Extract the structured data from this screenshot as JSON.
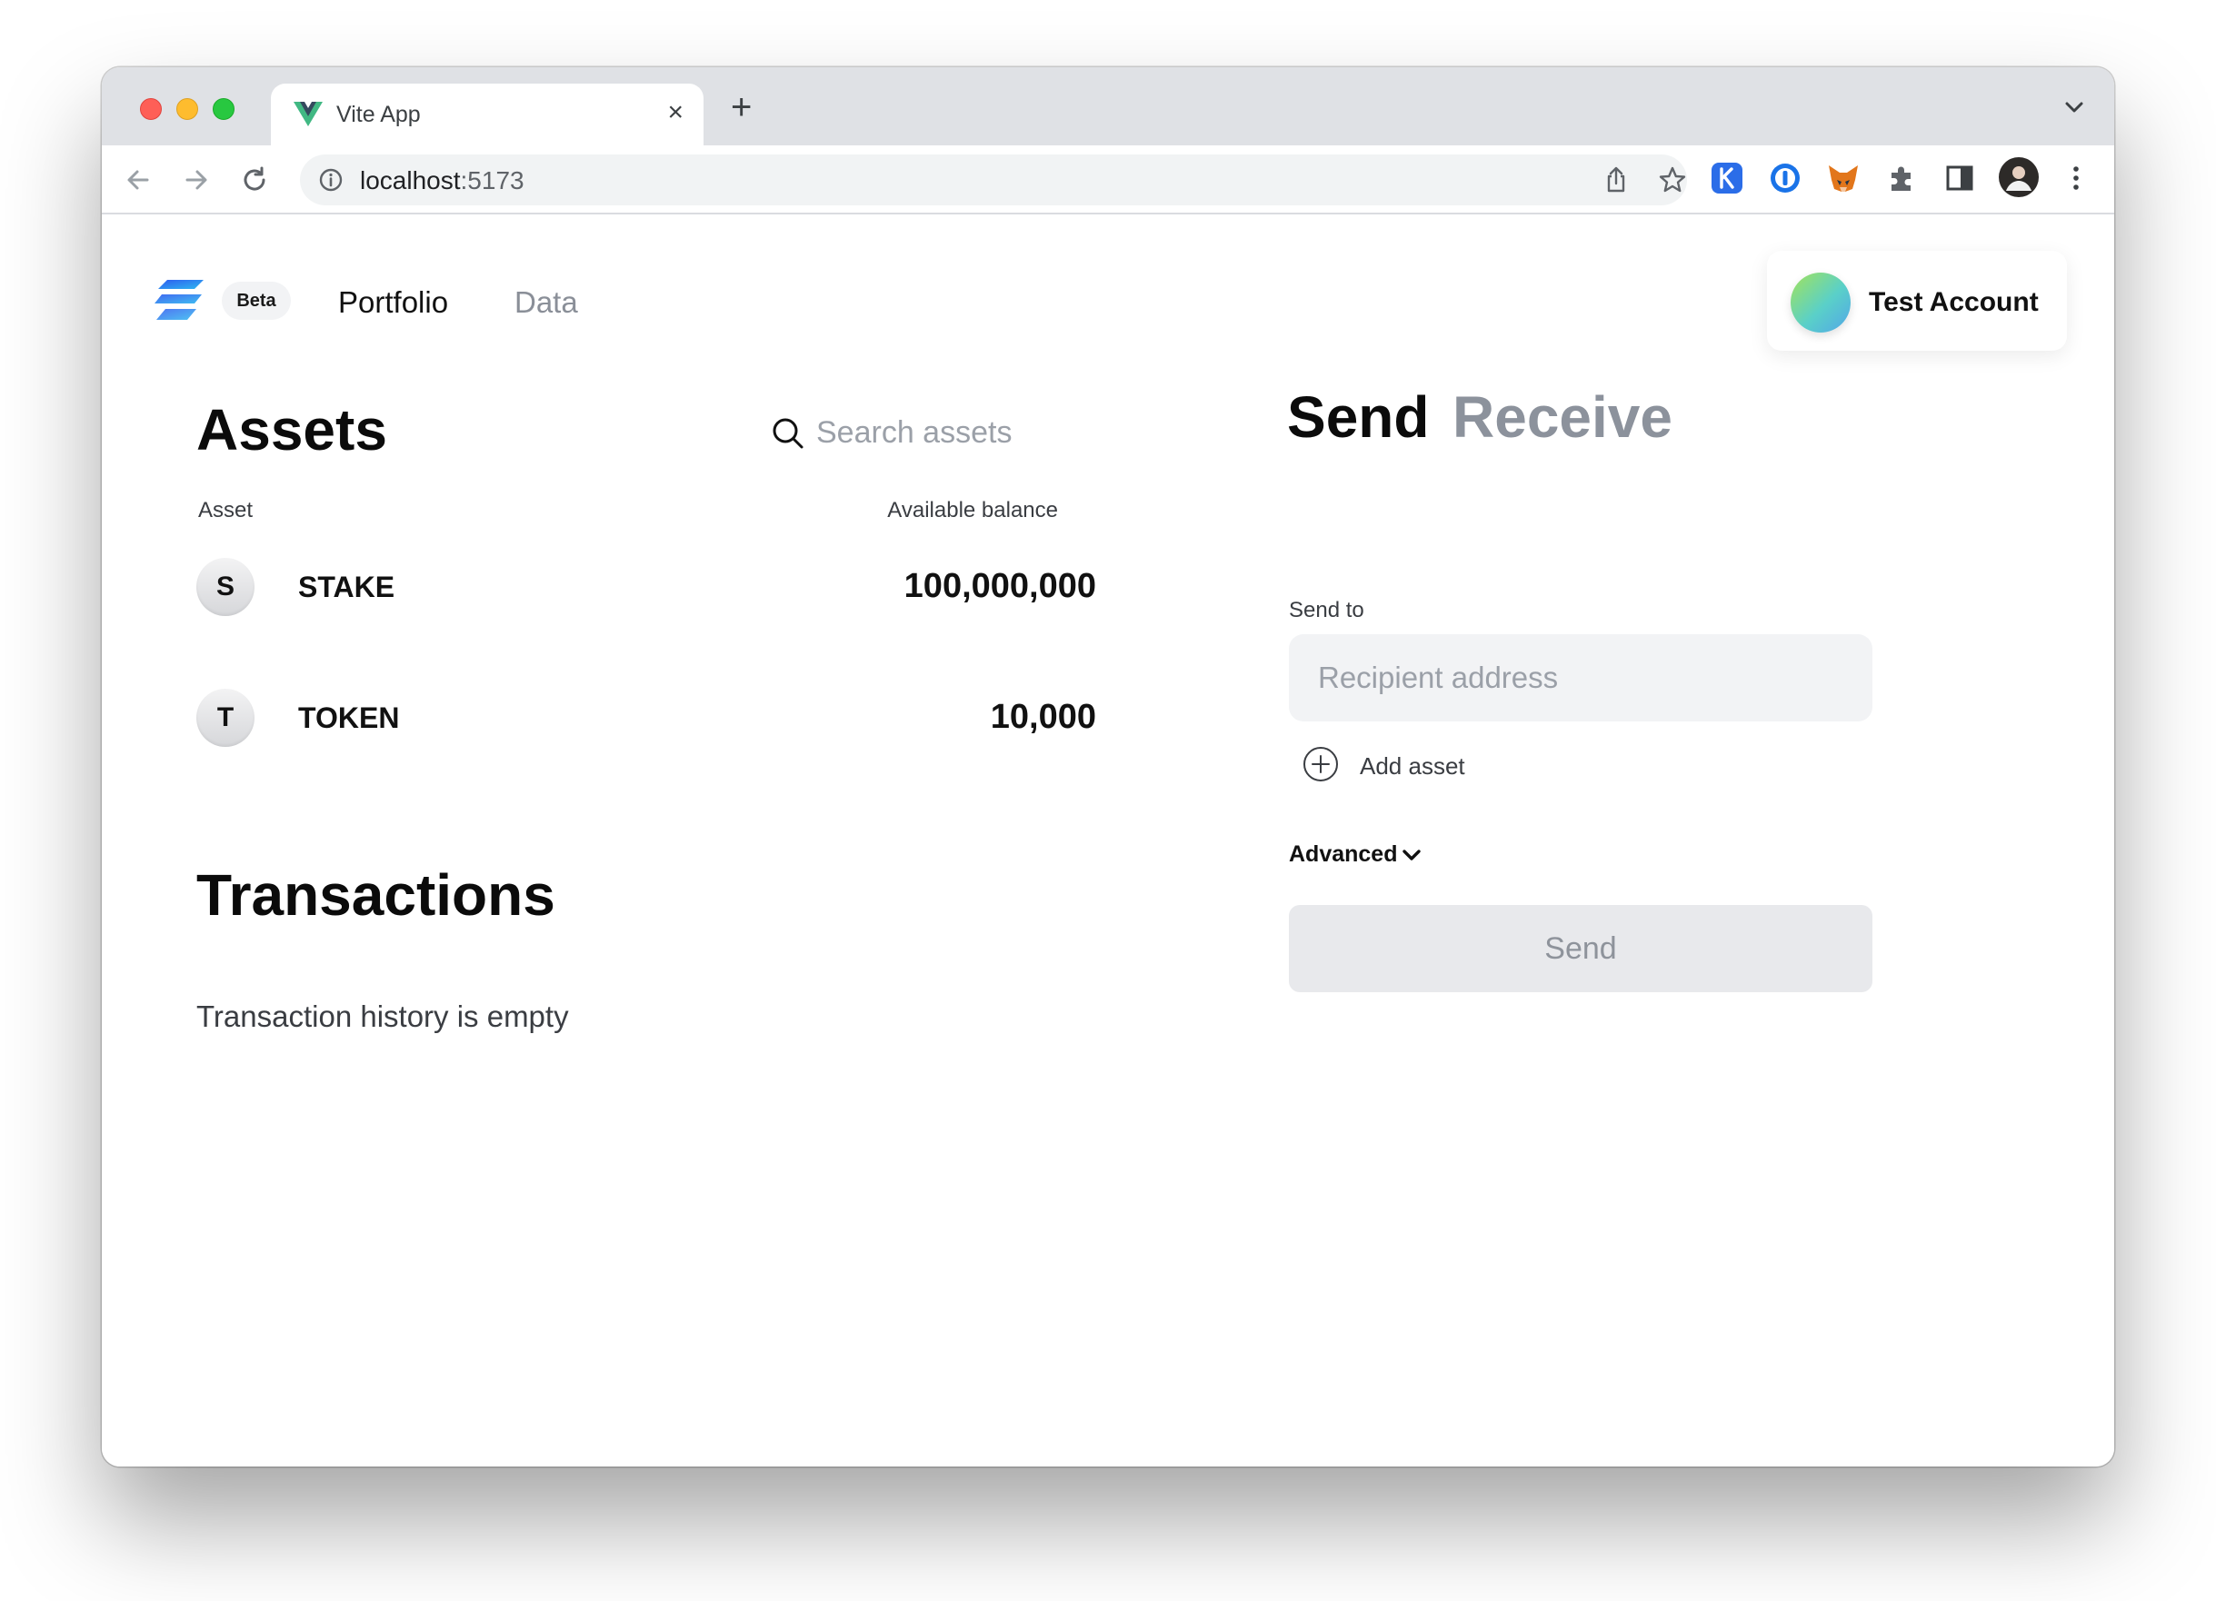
{
  "browser": {
    "tab_title": "Vite App",
    "tab_close": "×",
    "new_tab": "+",
    "url_host": "localhost",
    "url_port": ":5173",
    "icons": [
      "back-arrow-icon",
      "forward-arrow-icon",
      "reload-icon",
      "info-icon",
      "share-icon",
      "star-icon",
      "extension-k-icon",
      "password-manager-icon",
      "fox-wallet-icon",
      "puzzle-extensions-icon",
      "side-panel-icon",
      "profile-avatar-icon",
      "kebab-menu-icon"
    ]
  },
  "header": {
    "beta_label": "Beta",
    "nav": {
      "portfolio": "Portfolio",
      "data": "Data"
    },
    "account_name": "Test Account"
  },
  "assets": {
    "title": "Assets",
    "search_placeholder": "Search assets",
    "col_asset": "Asset",
    "col_balance": "Available balance",
    "rows": [
      {
        "letter": "S",
        "name": "STAKE",
        "amount": "100,000,000"
      },
      {
        "letter": "T",
        "name": "TOKEN",
        "amount": "10,000"
      }
    ]
  },
  "transactions": {
    "title": "Transactions",
    "empty_message": "Transaction history is empty"
  },
  "send_panel": {
    "tab_send": "Send",
    "tab_receive": "Receive",
    "send_to_label": "Send to",
    "recipient_placeholder": "Recipient address",
    "add_asset_label": "Add asset",
    "advanced_label": "Advanced",
    "send_button_label": "Send"
  },
  "colors": {
    "text_primary": "#111111",
    "text_muted": "#8c929c",
    "input_bg": "#f2f3f5",
    "button_disabled_bg": "#e8e9ec"
  }
}
